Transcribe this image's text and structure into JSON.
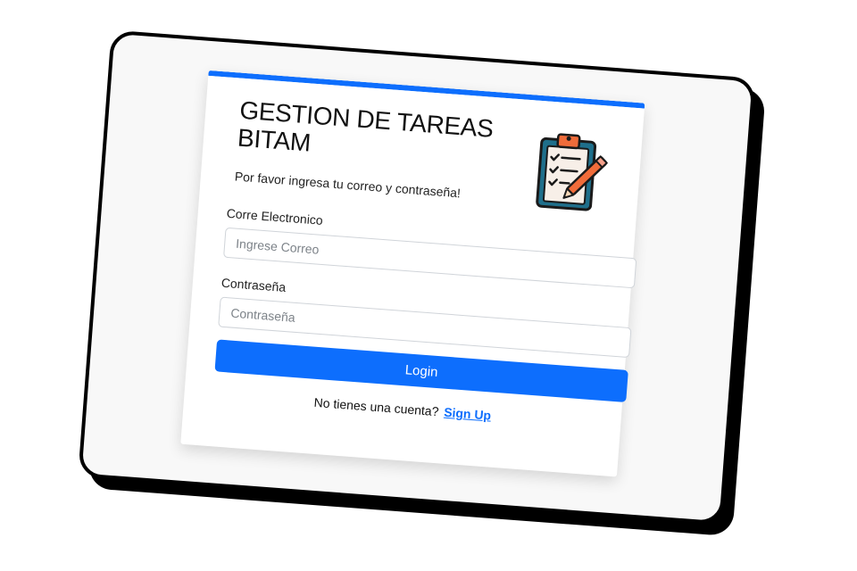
{
  "app": {
    "title": "GESTION DE TAREAS BITAM",
    "subtitle": "Por favor ingresa tu correo y contraseña!",
    "icon": "clipboard-checklist-pencil-icon"
  },
  "form": {
    "email_label": "Corre Electronico",
    "email_placeholder": "Ingrese Correo",
    "email_value": "",
    "password_label": "Contraseña",
    "password_placeholder": "Contraseña",
    "password_value": "",
    "login_label": "Login"
  },
  "footer": {
    "prompt": "No tienes una cuenta?",
    "signup_label": "Sign Up"
  },
  "colors": {
    "accent": "#0d6efd",
    "device_frame": "#000000",
    "clipboard_board": "#1f6f8b",
    "clipboard_clip": "#f06c3a",
    "pencil": "#f06c3a"
  }
}
